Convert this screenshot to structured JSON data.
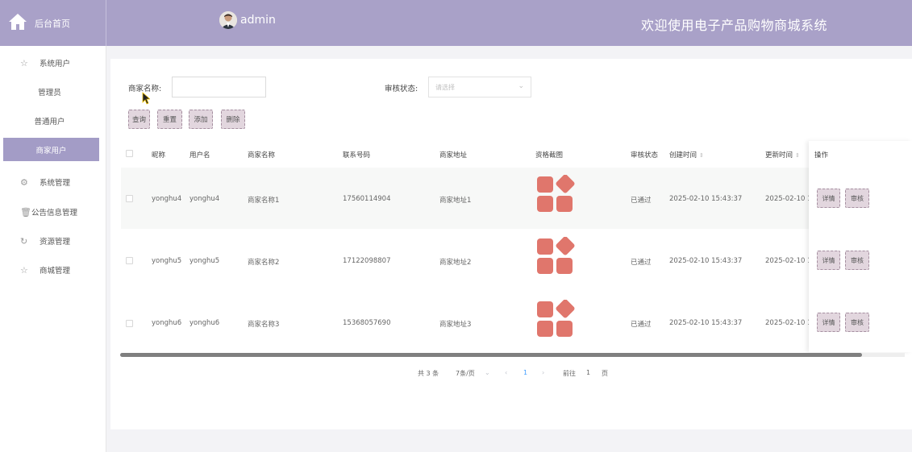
{
  "header": {
    "home_label": "后台首页",
    "username": "admin",
    "site_title": "欢迎使用电子产品购物商城系统"
  },
  "sidebar": {
    "items": [
      {
        "label": "系统用户",
        "icon": "star-outline-icon"
      },
      {
        "label": "管理员"
      },
      {
        "label": "普通用户"
      },
      {
        "label": "商家用户",
        "active": true
      },
      {
        "label": "系统管理",
        "icon": "gear-icon"
      },
      {
        "label": "公告信息管理",
        "icon": "trash-icon"
      },
      {
        "label": "资源管理",
        "icon": "refresh-icon"
      },
      {
        "label": "商城管理",
        "icon": "star-outline-icon"
      }
    ]
  },
  "search": {
    "merchant_label": "商家名称:",
    "merchant_value": "",
    "status_label": "审核状态:",
    "status_placeholder": "请选择"
  },
  "toolbar": {
    "query": "查询",
    "reset": "重置",
    "add": "添加",
    "delete": "删除"
  },
  "table": {
    "headers": {
      "nickname": "昵称",
      "username": "用户名",
      "merchant_name": "商家名称",
      "phone": "联系号码",
      "address": "商家地址",
      "qualification": "资格截图",
      "audit_status": "审核状态",
      "created": "创建时间",
      "updated": "更新时间",
      "actions": "操作"
    },
    "rows": [
      {
        "nickname": "yonghu4",
        "username": "yonghu4",
        "merchant_name": "商家名称1",
        "phone": "17560114904",
        "address": "商家地址1",
        "audit_status": "已通过",
        "created": "2025-02-10 15:43:37",
        "updated": "2025-02-10 15"
      },
      {
        "nickname": "yonghu5",
        "username": "yonghu5",
        "merchant_name": "商家名称2",
        "phone": "17122098807",
        "address": "商家地址2",
        "audit_status": "已通过",
        "created": "2025-02-10 15:43:37",
        "updated": "2025-02-10 15"
      },
      {
        "nickname": "yonghu6",
        "username": "yonghu6",
        "merchant_name": "商家名称3",
        "phone": "15368057690",
        "address": "商家地址3",
        "audit_status": "已通过",
        "created": "2025-02-10 15:43:37",
        "updated": "2025-02-10 15"
      }
    ],
    "row_actions": {
      "detail": "详情",
      "audit": "审核"
    }
  },
  "pagination": {
    "total": "共 3 条",
    "page_size": "7条/页",
    "prev": "‹",
    "current": "1",
    "next": "›",
    "goto_label": "前往",
    "goto_value": "1",
    "page_suffix": "页"
  },
  "colors": {
    "header_bg": "#a9a1c8",
    "active_menu": "#a39cc6",
    "button_bg": "#e2d6de",
    "thumb": "#e0766c"
  }
}
